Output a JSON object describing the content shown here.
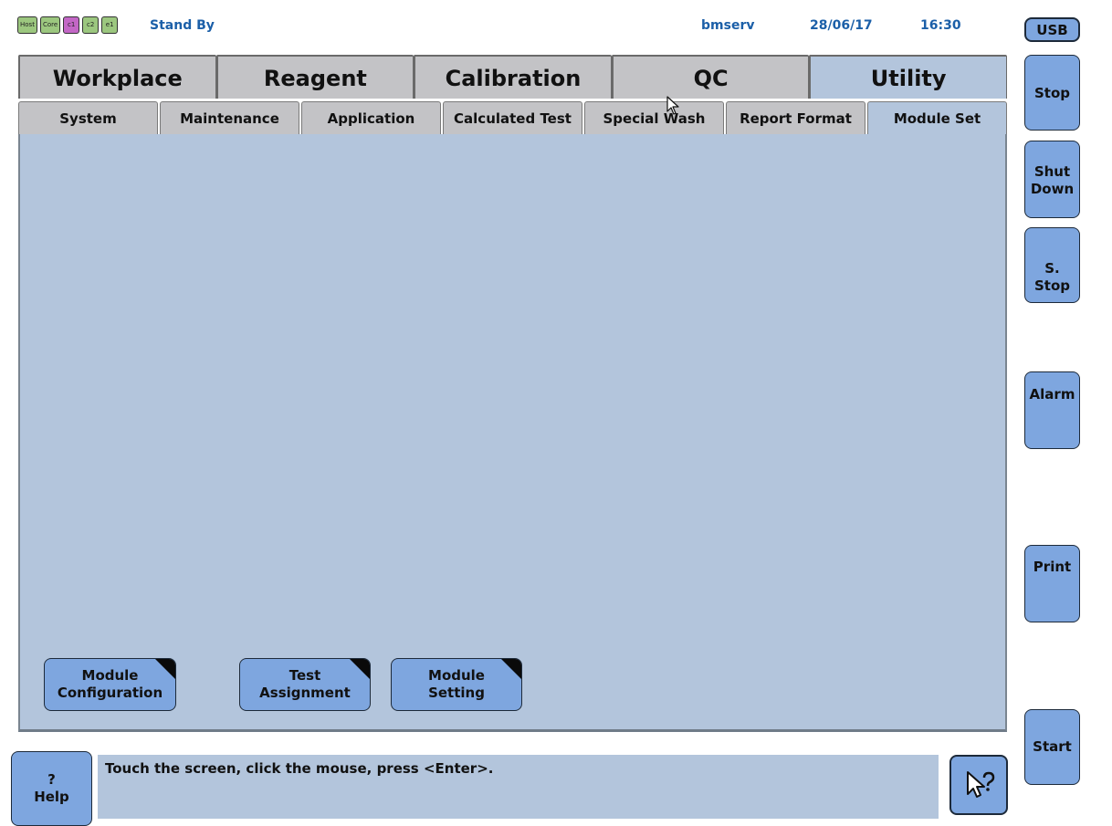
{
  "status_bar": {
    "indicators": [
      {
        "label": "Host",
        "color": "#9cc77f"
      },
      {
        "label": "Core",
        "color": "#9cc77f"
      },
      {
        "label": "c1",
        "color": "#c367c6"
      },
      {
        "label": "c2",
        "color": "#9cc77f"
      },
      {
        "label": "e1",
        "color": "#9cc77f"
      }
    ],
    "state": "Stand By",
    "user": "bmserv",
    "date": "28/06/17",
    "time": "16:30"
  },
  "main_tabs": [
    "Workplace",
    "Reagent",
    "Calibration",
    "QC",
    "Utility"
  ],
  "main_tab_active": "Utility",
  "sub_tabs": [
    "System",
    "Maintenance",
    "Application",
    "Calculated Test",
    "Special Wash",
    "Report Format",
    "Module Set"
  ],
  "sub_tab_active": "Module Set",
  "actions": {
    "module_configuration": "Module\nConfiguration",
    "test_assignment": "Test\nAssignment",
    "module_setting": "Module\nSetting"
  },
  "side_buttons": {
    "usb": "USB",
    "stop": "Stop",
    "shut_down": "Shut\nDown",
    "s_stop": "S. Stop",
    "alarm": "Alarm",
    "print": "Print",
    "start": "Start"
  },
  "help": {
    "symbol": "?",
    "label": "Help"
  },
  "message": "Touch the screen, click the mouse, press <Enter>.",
  "colors": {
    "accent": "#1b5fa8",
    "button": "#7ea6df",
    "panel": "#b3c5dc",
    "tab": "#c3c3c6"
  },
  "icons": {
    "pointer_help": "pointer-question-icon",
    "cursor": "mouse-cursor-icon"
  }
}
